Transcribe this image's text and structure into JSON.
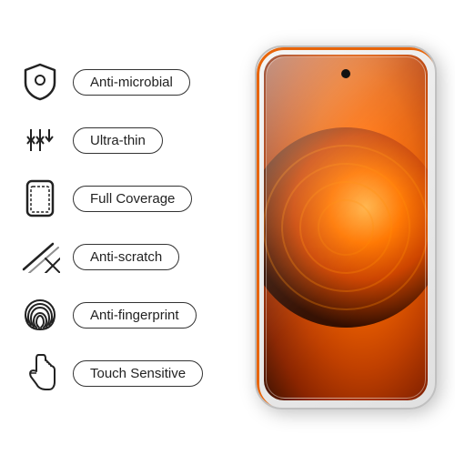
{
  "features": [
    {
      "id": "anti-microbial",
      "label": "Anti-microbial",
      "icon": "shield"
    },
    {
      "id": "ultra-thin",
      "label": "Ultra-thin",
      "icon": "arrows"
    },
    {
      "id": "full-coverage",
      "label": "Full Coverage",
      "icon": "phone-frame"
    },
    {
      "id": "anti-scratch",
      "label": "Anti-scratch",
      "icon": "scratch"
    },
    {
      "id": "anti-fingerprint",
      "label": "Anti-fingerprint",
      "icon": "fingerprint"
    },
    {
      "id": "touch-sensitive",
      "label": "Touch Sensitive",
      "icon": "hand"
    }
  ],
  "colors": {
    "accent": "#e8650a",
    "text": "#222222",
    "border": "#333333"
  }
}
